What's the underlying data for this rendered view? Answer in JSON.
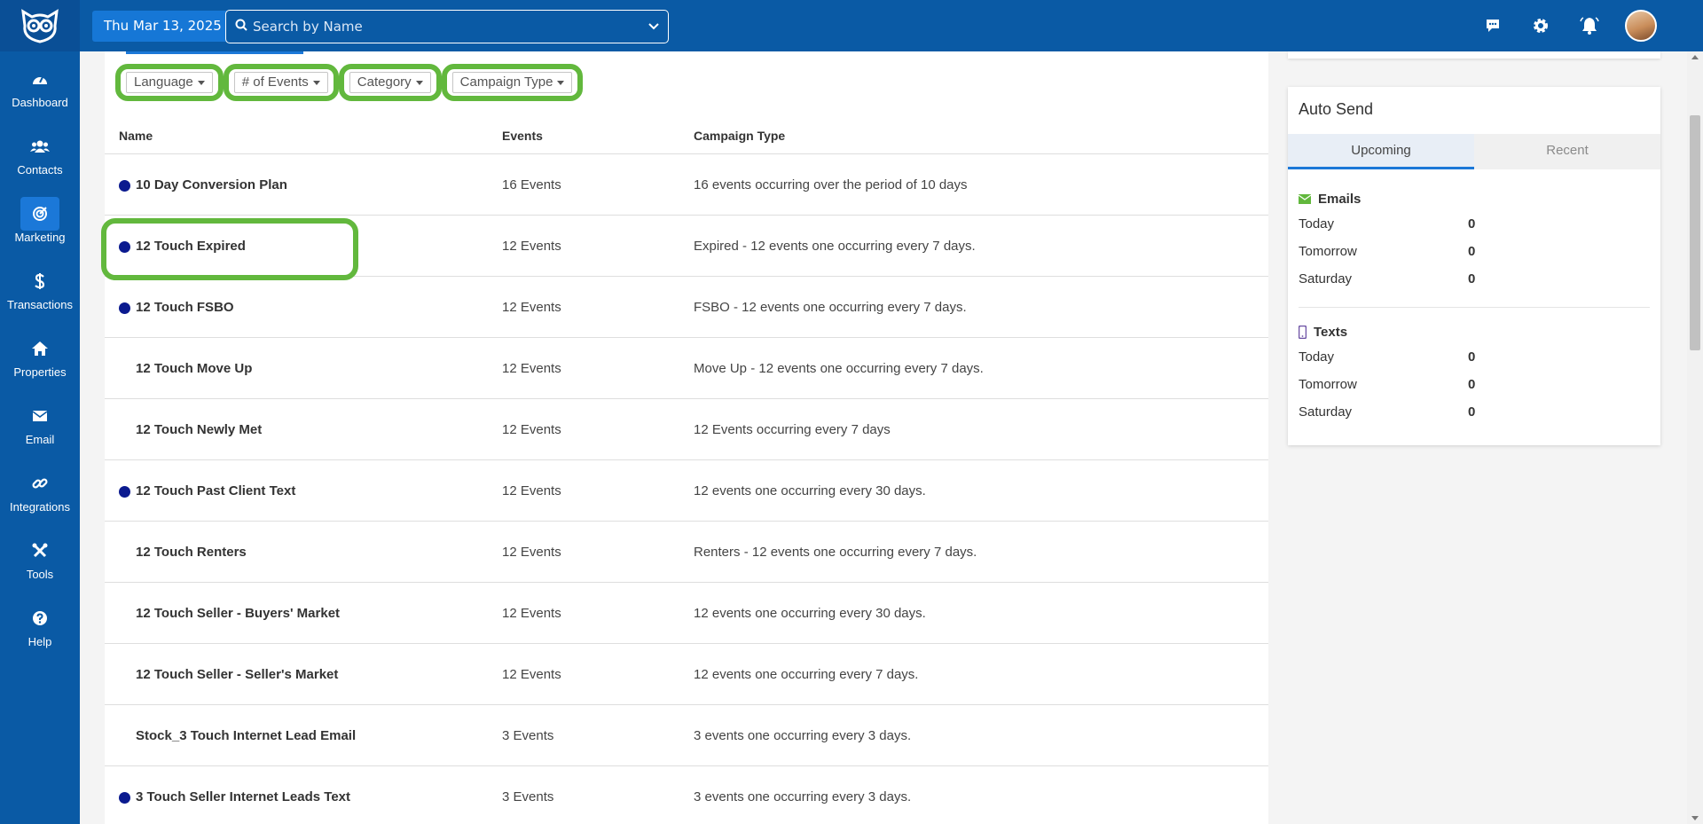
{
  "header": {
    "date": "Thu Mar 13, 2025",
    "search_placeholder": "Search by Name"
  },
  "sidebar": {
    "items": [
      {
        "label": "Dashboard",
        "icon": "gauge-icon"
      },
      {
        "label": "Contacts",
        "icon": "users-icon"
      },
      {
        "label": "Marketing",
        "icon": "target-icon"
      },
      {
        "label": "Transactions",
        "icon": "dollar-icon"
      },
      {
        "label": "Properties",
        "icon": "home-icon"
      },
      {
        "label": "Email",
        "icon": "envelope-icon"
      },
      {
        "label": "Integrations",
        "icon": "link-icon"
      },
      {
        "label": "Tools",
        "icon": "tools-icon"
      },
      {
        "label": "Help",
        "icon": "question-icon"
      }
    ]
  },
  "filters": [
    "Language",
    "# of Events",
    "Category",
    "Campaign Type"
  ],
  "table": {
    "columns": [
      "Name",
      "Events",
      "Campaign Type"
    ],
    "rows": [
      {
        "name": "10 Day Conversion Plan",
        "events": "16 Events",
        "type": "16 events occurring over the period of 10 days",
        "dot": true
      },
      {
        "name": "12 Touch Expired",
        "events": "12 Events",
        "type": "Expired - 12 events one occurring every 7 days.",
        "dot": true
      },
      {
        "name": "12 Touch FSBO",
        "events": "12 Events",
        "type": "FSBO - 12 events one occurring every 7 days.",
        "dot": true
      },
      {
        "name": "12 Touch Move Up",
        "events": "12 Events",
        "type": "Move Up - 12 events one occurring every 7 days.",
        "dot": false
      },
      {
        "name": "12 Touch Newly Met",
        "events": "12 Events",
        "type": "12 Events occurring every 7 days",
        "dot": false
      },
      {
        "name": "12 Touch Past Client Text",
        "events": "12 Events",
        "type": "12 events one occurring every 30 days.",
        "dot": true
      },
      {
        "name": "12 Touch Renters",
        "events": "12 Events",
        "type": "Renters - 12 events one occurring every 7 days.",
        "dot": false
      },
      {
        "name": "12 Touch Seller - Buyers' Market",
        "events": "12 Events",
        "type": "12 events one occurring every 30 days.",
        "dot": false
      },
      {
        "name": "12 Touch Seller - Seller's Market",
        "events": "12 Events",
        "type": "12 events one occurring every 7 days.",
        "dot": false
      },
      {
        "name": "Stock_3 Touch Internet Lead Email",
        "events": "3 Events",
        "type": "3 events one occurring every 3 days.",
        "dot": false
      },
      {
        "name": "3 Touch Seller Internet Leads Text",
        "events": "3 Events",
        "type": "3 events one occurring every 3 days.",
        "dot": true
      }
    ]
  },
  "autosend": {
    "title": "Auto Send",
    "tabs": [
      "Upcoming",
      "Recent"
    ],
    "emails": {
      "heading": "Emails",
      "rows": [
        {
          "label": "Today",
          "value": "0"
        },
        {
          "label": "Tomorrow",
          "value": "0"
        },
        {
          "label": "Saturday",
          "value": "0"
        }
      ]
    },
    "texts": {
      "heading": "Texts",
      "rows": [
        {
          "label": "Today",
          "value": "0"
        },
        {
          "label": "Tomorrow",
          "value": "0"
        },
        {
          "label": "Saturday",
          "value": "0"
        }
      ]
    }
  },
  "colors": {
    "brand": "#0a5aa5",
    "highlight": "#62b83d",
    "dot": "#0b1a8f",
    "accent": "#1b78d8"
  }
}
